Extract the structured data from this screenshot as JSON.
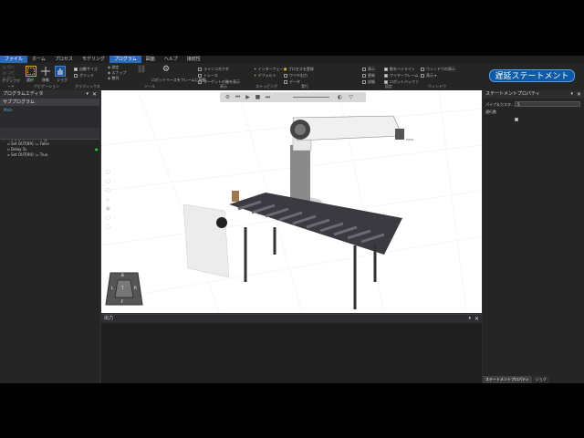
{
  "menu": {
    "items": [
      "ファイル",
      "ホーム",
      "プロセス",
      "モデリング",
      "プログラム",
      "図面",
      "ヘルプ",
      "接続性"
    ],
    "active_index": 4
  },
  "ribbon": {
    "groups": [
      "クリップボード",
      "ナビゲーション",
      "グラフィックス",
      "ツール",
      "表示",
      "ステッピング",
      "実行",
      "設定",
      "ウィンドウ"
    ],
    "nav": {
      "select": "選択",
      "move": "移動",
      "jog": "ジョグ"
    },
    "snap": {
      "auto_size": "自動サイズ",
      "snap_grid": "グリッド"
    },
    "tools": {
      "measure": "測定",
      "snap": "スナップ",
      "pivot": "整列",
      "robot_frame": "ロボットベースをフレームに移動"
    },
    "display": {
      "item1": "ラインコネクタ",
      "item2": "トレース",
      "item3": "ターゲットの軸を表示"
    },
    "step": {
      "interface": "インターフェース",
      "default": "デフォルト"
    },
    "run": {
      "item1": "プロセスを登録",
      "item2": "ワイヤ出力",
      "item3": "データ"
    },
    "settings": {
      "item1": "表示",
      "item2": "更新",
      "item3": "詳細",
      "item4": "影をハイライト",
      "item5": "ワイヤーフレーム",
      "item6": "ロボットバッファ"
    },
    "window": {
      "item1": "ウィンドウの表示",
      "item2": "表示"
    },
    "highlight_button": "遅延ステートメント"
  },
  "left_panel": {
    "title": "プログラムエディタ",
    "subtitle": "サブプログラム",
    "main_label": "Main",
    "statements": [
      "Set OUT[89] := False",
      "Delay 5s",
      "Set OUT[90] := True"
    ]
  },
  "right_panel": {
    "title": "ステートメントプロパティ",
    "prop1_label": "パイプ＆カスタ...",
    "prop1_value": "5",
    "prop2_label": "遅行数",
    "tabs": [
      "ステートメントプロパティ",
      "ジョグ"
    ]
  },
  "output": {
    "title": "出力"
  },
  "viewport": {
    "nav_cube": {
      "top": "B",
      "left": "L",
      "right": "R",
      "bottom": "F",
      "center": "T"
    },
    "label": "TOOL"
  },
  "colors": {
    "accent": "#0d5aa7",
    "active_menu": "#2a6ab6",
    "panel_bg": "#252526"
  }
}
